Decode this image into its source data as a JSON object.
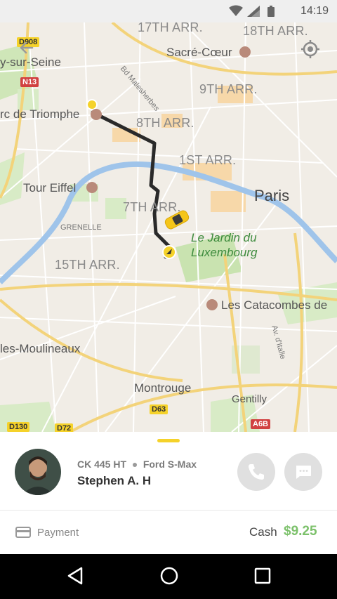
{
  "status_bar": {
    "time": "14:19"
  },
  "map": {
    "labels": {
      "arr17": "17TH ARR.",
      "arr18": "18TH ARR.",
      "sacre_coeur": "Sacré-Cœur",
      "sur_seine": "y-sur-Seine",
      "arr9": "9TH ARR.",
      "triomphe": "rc de Triomphe",
      "arr8": "8TH ARR.",
      "arr1": "1ST ARR.",
      "paris": "Paris",
      "tour_eiffel": "Tour Eiffel",
      "arr7": "7TH ARR.",
      "grenelle": "GRENELLE",
      "jardin_line1": "Le Jardin du",
      "jardin_line2": "Luxembourg",
      "arr15": "15TH ARR.",
      "catacombes": "Les Catacombes de",
      "moulineaux": "les-Moulineaux",
      "montrouge": "Montrouge",
      "gentilly": "Gentilly",
      "bd_malesherbes": "Bd Malesherbes",
      "av_italie": "Av. d'Italie"
    },
    "road_badges": {
      "d908": "D908",
      "n13": "N13",
      "d63": "D63",
      "d130": "D130",
      "d72": "D72",
      "a6b": "A6B"
    }
  },
  "ride": {
    "plate": "CK 445 HT",
    "car_model": "Ford S-Max",
    "driver_name": "Stephen A. H"
  },
  "payment": {
    "label": "Payment",
    "method": "Cash",
    "amount": "$9.25"
  },
  "colors": {
    "accent": "#f5d22a",
    "price": "#7cc16b",
    "route": "#2a2a2a",
    "water": "#9fc4ea"
  }
}
